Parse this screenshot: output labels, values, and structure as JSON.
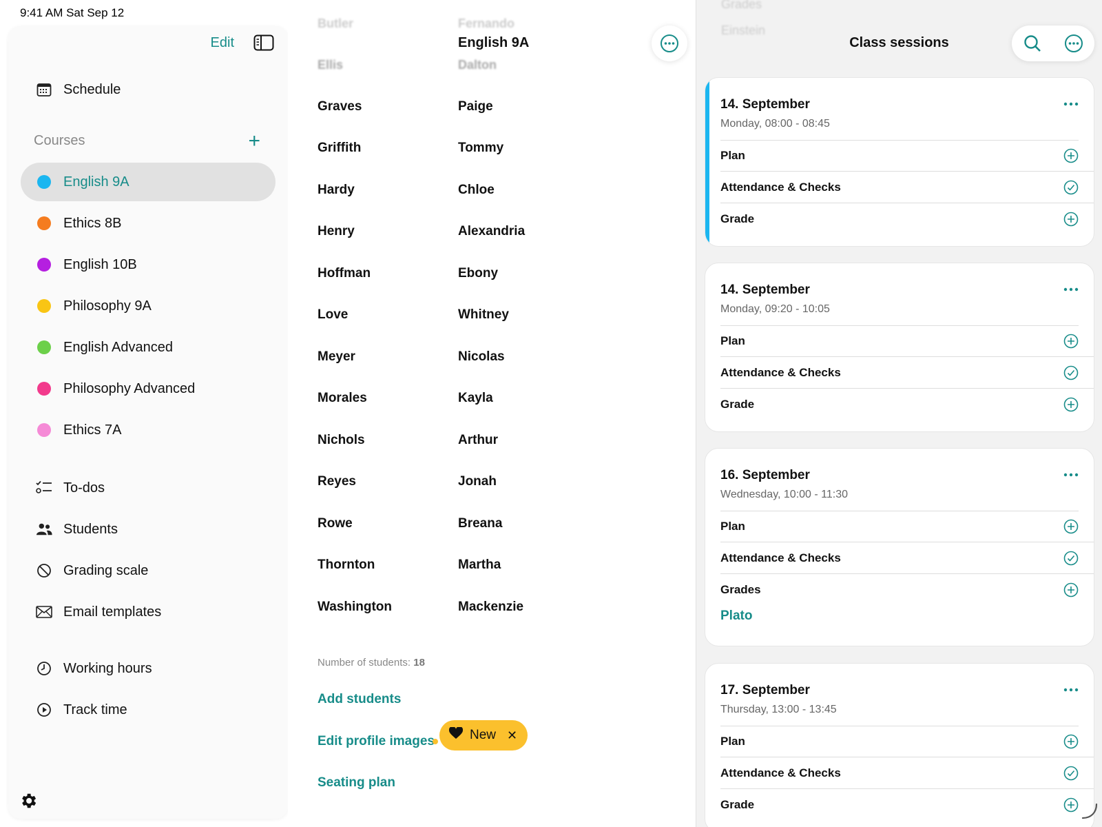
{
  "status_bar": {
    "time_date": "9:41 AM   Sat Sep 12"
  },
  "sidebar": {
    "edit_label": "Edit",
    "schedule_label": "Schedule",
    "courses_label": "Courses",
    "courses": [
      {
        "label": "English 9A",
        "color": "#1bb6f0",
        "selected": true
      },
      {
        "label": "Ethics 8B",
        "color": "#f57c1f",
        "selected": false
      },
      {
        "label": "English 10B",
        "color": "#b51fe0",
        "selected": false
      },
      {
        "label": "Philosophy 9A",
        "color": "#f9c514",
        "selected": false
      },
      {
        "label": "English Advanced",
        "color": "#6cd04a",
        "selected": false
      },
      {
        "label": "Philosophy Advanced",
        "color": "#f23a8c",
        "selected": false
      },
      {
        "label": "Ethics 7A",
        "color": "#f58ad6",
        "selected": false
      }
    ],
    "tools": [
      {
        "label": "To-dos",
        "icon": "todo-list-icon"
      },
      {
        "label": "Students",
        "icon": "people-icon"
      },
      {
        "label": "Grading scale",
        "icon": "grading-scale-icon"
      },
      {
        "label": "Email templates",
        "icon": "envelope-icon"
      }
    ],
    "time_tools": [
      {
        "label": "Working hours",
        "icon": "clock-icon"
      },
      {
        "label": "Track time",
        "icon": "play-circle-icon"
      }
    ],
    "accent_color": "#178c89"
  },
  "student_list": {
    "title": "English 9A",
    "faded_rows": [
      {
        "last": "Butler",
        "first": "Fernando"
      },
      {
        "last": "Ellis",
        "first": "Dalton"
      }
    ],
    "rows": [
      {
        "last": "Graves",
        "first": "Paige"
      },
      {
        "last": "Griffith",
        "first": "Tommy"
      },
      {
        "last": "Hardy",
        "first": "Chloe"
      },
      {
        "last": "Henry",
        "first": "Alexandria"
      },
      {
        "last": "Hoffman",
        "first": "Ebony"
      },
      {
        "last": "Love",
        "first": "Whitney"
      },
      {
        "last": "Meyer",
        "first": "Nicolas"
      },
      {
        "last": "Morales",
        "first": "Kayla"
      },
      {
        "last": "Nichols",
        "first": "Arthur"
      },
      {
        "last": "Reyes",
        "first": "Jonah"
      },
      {
        "last": "Rowe",
        "first": "Breana"
      },
      {
        "last": "Thornton",
        "first": "Martha"
      },
      {
        "last": "Washington",
        "first": "Mackenzie"
      }
    ],
    "count_label": "Number of students:",
    "count_value": "18",
    "add_students": "Add students",
    "edit_profile_images": "Edit profile images",
    "new_badge": "New",
    "seating_plan": "Seating plan"
  },
  "sessions": {
    "title": "Class sessions",
    "faded_top": [
      "Grades",
      "Einstein"
    ],
    "cards": [
      {
        "date": "14. September",
        "time": "Monday, 08:00 - 08:45",
        "accent": true,
        "rows": [
          {
            "label": "Plan",
            "icon": "plus-circle-icon"
          },
          {
            "label": "Attendance & Checks",
            "icon": "check-circle-icon"
          },
          {
            "label": "Grade",
            "icon": "plus-circle-icon"
          }
        ]
      },
      {
        "date": "14. September",
        "time": "Monday, 09:20 - 10:05",
        "accent": false,
        "rows": [
          {
            "label": "Plan",
            "icon": "plus-circle-icon"
          },
          {
            "label": "Attendance & Checks",
            "icon": "check-circle-icon"
          },
          {
            "label": "Grade",
            "icon": "plus-circle-icon"
          }
        ]
      },
      {
        "date": "16. September",
        "time": "Wednesday, 10:00 - 11:30",
        "accent": false,
        "rows": [
          {
            "label": "Plan",
            "icon": "plus-circle-icon"
          },
          {
            "label": "Attendance & Checks",
            "icon": "check-circle-icon"
          },
          {
            "label": "Grades",
            "icon": "plus-circle-icon"
          }
        ],
        "extra": "Plato"
      },
      {
        "date": "17. September",
        "time": "Thursday, 13:00 - 13:45",
        "accent": false,
        "rows": [
          {
            "label": "Plan",
            "icon": "plus-circle-icon"
          },
          {
            "label": "Attendance & Checks",
            "icon": "check-circle-icon"
          },
          {
            "label": "Grade",
            "icon": "plus-circle-icon"
          }
        ]
      }
    ]
  }
}
